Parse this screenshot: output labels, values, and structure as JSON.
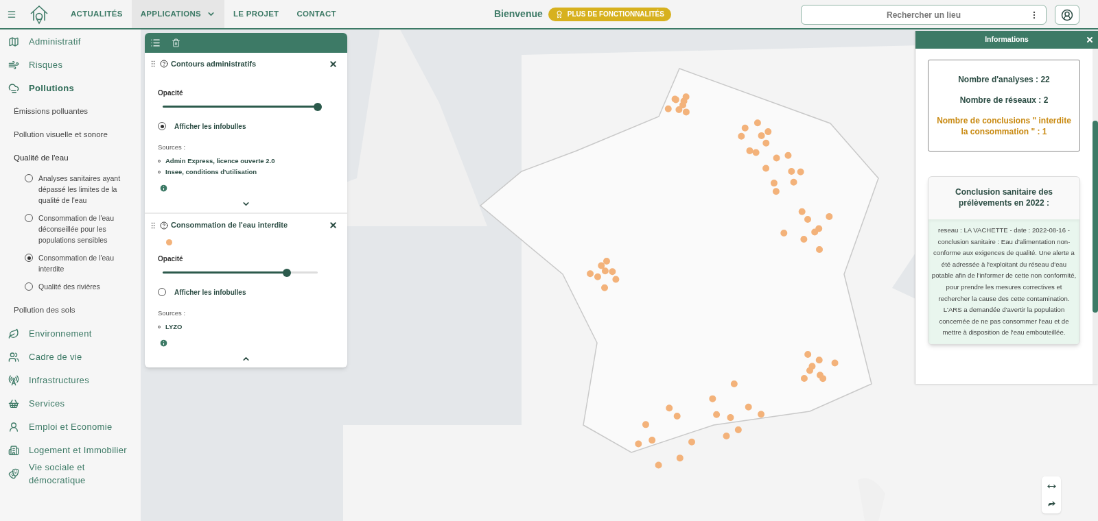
{
  "header": {
    "nav": [
      {
        "label": "ACTUALITÉS",
        "selected": false,
        "dropdown": false
      },
      {
        "label": "APPLICATIONS",
        "selected": true,
        "dropdown": true
      },
      {
        "label": "LE PROJET",
        "selected": false,
        "dropdown": false
      },
      {
        "label": "CONTACT",
        "selected": false,
        "dropdown": false
      }
    ],
    "welcome": "Bienvenue",
    "premium_button": "PLUS DE FONCTIONNALITÉS",
    "search": {
      "placeholder": "Rechercher un lieu"
    }
  },
  "sidebar": {
    "items": [
      {
        "label": "Administratif",
        "expanded": false
      },
      {
        "label": "Risques",
        "expanded": false
      },
      {
        "label": "Pollutions",
        "expanded": true,
        "children": [
          {
            "label": "Émissions polluantes",
            "expanded": false
          },
          {
            "label": "Pollution visuelle et sonore",
            "expanded": false
          },
          {
            "label": "Qualité de l'eau",
            "expanded": true,
            "children": [
              {
                "label": "Analyses sanitaires ayant dépassé les limites de la qualité de l'eau",
                "selected": false
              },
              {
                "label": "Consommation de l'eau déconseillée pour les populations sensibles",
                "selected": false
              },
              {
                "label": "Consommation de l'eau interdite",
                "selected": true
              },
              {
                "label": "Qualité des rivières",
                "selected": false
              }
            ]
          },
          {
            "label": "Pollution des sols",
            "expanded": false
          }
        ]
      },
      {
        "label": "Environnement",
        "expanded": false
      },
      {
        "label": "Cadre de vie",
        "expanded": false
      },
      {
        "label": "Infrastructures",
        "expanded": false
      },
      {
        "label": "Services",
        "expanded": false
      },
      {
        "label": "Emploi et Economie",
        "expanded": false
      },
      {
        "label": "Logement et Immobilier",
        "expanded": false
      },
      {
        "label": "Vie sociale et démocratique",
        "expanded": false
      }
    ]
  },
  "layers": [
    {
      "title": "Contours administratifs",
      "opacity_label": "Opacité",
      "level": 1.0,
      "tooltips": {
        "label": "Afficher les infobulles",
        "checked": true
      },
      "sources_label": "Sources :",
      "sources": [
        "Admin Express, licence ouverte 2.0",
        "Insee, conditions d'utilisation"
      ],
      "expanded": false
    },
    {
      "title": "Consommation de l'eau interdite",
      "color": "#f3b27a",
      "opacity_label": "Opacité",
      "level": 0.8,
      "tooltips": {
        "label": "Afficher les infobulles",
        "checked": false
      },
      "sources_label": "Sources :",
      "sources": [
        "LYZO"
      ],
      "expanded": true
    }
  ],
  "info_panel": {
    "title": "Informations",
    "stats": [
      {
        "text": "Nombre d'analyses : 22",
        "kind": "normal"
      },
      {
        "text": "Nombre de réseaux : 2",
        "kind": "normal"
      },
      {
        "text": "Nombre de conclusions \" interdite la consommation \" : 1",
        "kind": "alert"
      }
    ],
    "conclusion_title": "Conclusion sanitaire des prélèvements en 2022 :",
    "conclusion_text": "reseau : LA VACHETTE - date : 2022-08-16 - conclusion sanitaire : Eau d'alimentation non-conforme aux exigences de qualité. Une alerte a été adressée à l'exploitant du réseau d'eau potable afin de l'informer de cette non conformité, pour prendre les mesures correctives et rechercher la cause des cette contamination. L'ARS a demandée d'avertir la population concernée de ne pas consommer l'eau et de mettre à disposition de l'eau embouteillée."
  }
}
